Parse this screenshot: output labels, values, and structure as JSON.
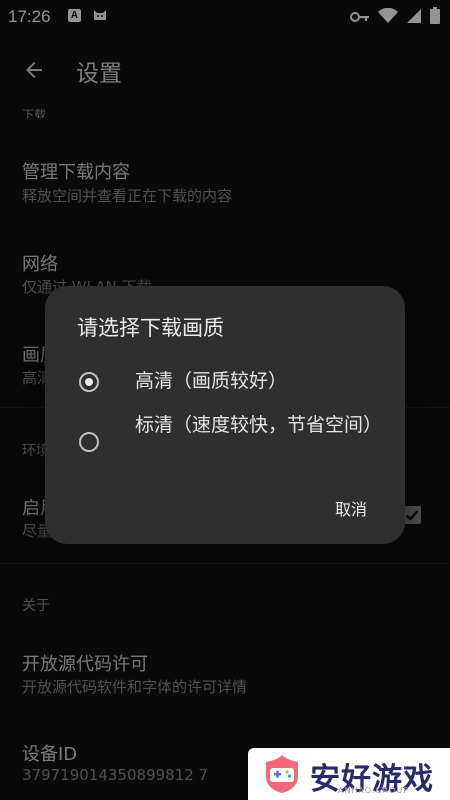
{
  "status_bar": {
    "time": "17:26",
    "badge": "A",
    "icons": [
      "notification-a-icon",
      "cat-icon",
      "key-icon",
      "wifi-icon",
      "signal-icon",
      "battery-icon"
    ]
  },
  "app_bar": {
    "title": "设置",
    "back_icon": "arrow-back-icon"
  },
  "settings": {
    "section_download_cut": "下载",
    "manage_downloads": {
      "title": "管理下载内容",
      "subtitle": "释放空间并查看正在下载的内容"
    },
    "network": {
      "title": "网络",
      "subtitle": "仅通过 WLAN 下载"
    },
    "quality": {
      "title": "画质",
      "subtitle": "高清"
    },
    "section_env": "环境",
    "startup": {
      "title": "启用",
      "subtitle": "尽量",
      "checked": true
    },
    "section_about": "关于",
    "licenses": {
      "title": "开放源代码许可",
      "subtitle": "开放源代码软件和字体的许可详情"
    },
    "device": {
      "title": "设备ID",
      "subtitle": "379719014350899812 7"
    }
  },
  "dialog": {
    "title": "请选择下载画质",
    "options": [
      {
        "label": "高清（画质较好）",
        "selected": true
      },
      {
        "label": "标清（速度较快，节省空间）",
        "selected": false
      }
    ],
    "cancel_label": "取消"
  },
  "watermark": {
    "text": "安好游戏",
    "sub": "ANHAO.GROUP"
  },
  "colors": {
    "background": "#121212",
    "dialog": "#2f2f2f",
    "brand_text": "#2a2a6a"
  }
}
